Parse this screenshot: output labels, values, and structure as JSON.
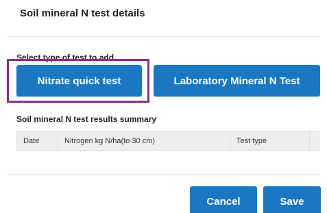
{
  "dialog": {
    "title": "Soil mineral N test details"
  },
  "add_test": {
    "label": "Select type of test to add",
    "buttons": [
      {
        "label": "Nitrate quick test"
      },
      {
        "label": "Laboratory Mineral N Test"
      }
    ],
    "highlight_color": "#8a2d8d"
  },
  "summary": {
    "label": "Soil mineral N test results summary",
    "columns": [
      "Date",
      "Nitrogen kg N/ha(to 30 cm)",
      "Test type",
      ""
    ]
  },
  "footer": {
    "cancel_label": "Cancel",
    "save_label": "Save"
  },
  "colors": {
    "primary_button": "#1a78c2",
    "table_header_bg": "#eeeeee"
  }
}
